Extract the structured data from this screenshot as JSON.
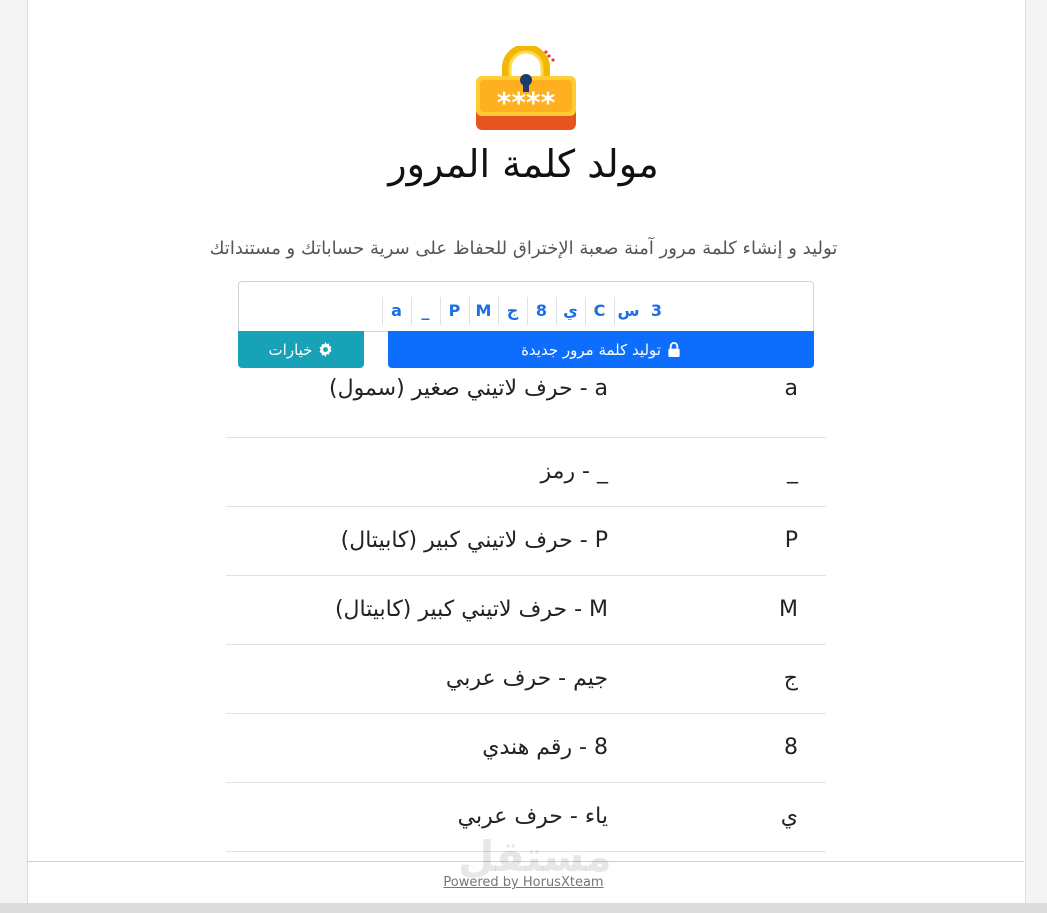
{
  "header": {
    "title": "مولد كلمة المرور",
    "subtitle": "توليد و إنشاء كلمة مرور آمنة صعبة الإختراق للحفاظ على سرية حساباتك و مستنداتك",
    "logo_icon": "padlock-password-icon"
  },
  "password": {
    "chars": [
      "a",
      "_",
      "P",
      "M",
      "ج",
      "8",
      "ي",
      "C",
      "س",
      "3"
    ]
  },
  "buttons": {
    "generate_label": "توليد كلمة مرور جديدة",
    "generate_icon": "lock-icon",
    "options_label": "خيارات",
    "options_icon": "gear-icon"
  },
  "breakdown": [
    {
      "char": "a",
      "desc": "a - حرف لاتيني صغير (سمول)"
    },
    {
      "char": "_",
      "desc": "_ - رمز"
    },
    {
      "char": "P",
      "desc": "P - حرف لاتيني كبير (كابيتال)"
    },
    {
      "char": "M",
      "desc": "M - حرف لاتيني كبير (كابيتال)"
    },
    {
      "char": "ج",
      "desc": "جيم - حرف عربي"
    },
    {
      "char": "8",
      "desc": "8 - رقم هندي"
    },
    {
      "char": "ي",
      "desc": "ياء - حرف عربي"
    }
  ],
  "footer": {
    "watermark": "مستقل",
    "powered_by": "Powered by HorusXteam"
  },
  "colors": {
    "primary": "#0d6efd",
    "info": "#17a2b8",
    "char_blue": "#1f6fe0"
  }
}
